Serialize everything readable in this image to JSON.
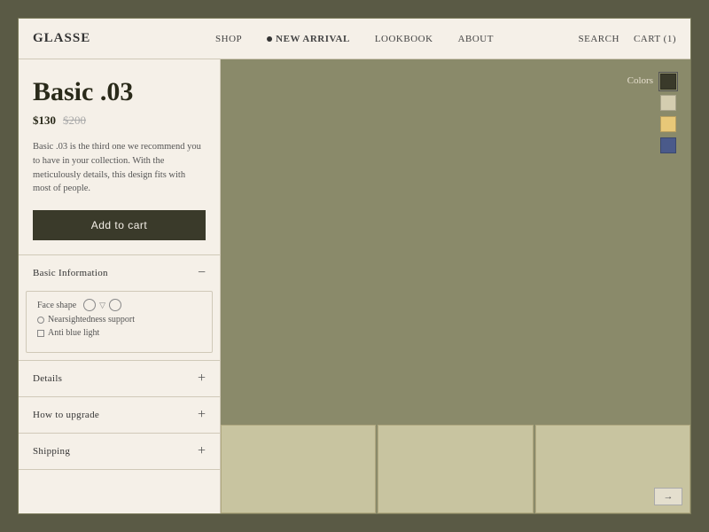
{
  "navbar": {
    "logo": "GLASSE",
    "nav_items": [
      {
        "label": "SHOP",
        "active": false,
        "dot": false
      },
      {
        "label": "NEW ARRIVAL",
        "active": true,
        "dot": true
      },
      {
        "label": "LOOKBOOK",
        "active": false,
        "dot": false
      },
      {
        "label": "ABOUT",
        "active": false,
        "dot": false
      }
    ],
    "search_label": "Search",
    "cart_label": "Cart (1)"
  },
  "product": {
    "title": "Basic .03",
    "price_current": "$130",
    "price_original": "$200",
    "description": "Basic .03 is the third one we recommend you to have in your collection. With the meticulously details, this design fits with most of people.",
    "add_to_cart_label": "Add to cart"
  },
  "accordion": {
    "basic_info": {
      "label": "Basic Information",
      "icon_open": "−",
      "face_shape_label": "Face shape",
      "features": [
        {
          "icon": "circle",
          "label": "Nearsightedness support"
        },
        {
          "icon": "square",
          "label": "Anti blue light"
        }
      ]
    },
    "details": {
      "label": "Details",
      "icon": "+"
    },
    "upgrade": {
      "label": "How to upgrade",
      "icon": "+"
    },
    "shipping": {
      "label": "Shipping",
      "icon": "+"
    }
  },
  "colors": {
    "label": "Colors",
    "swatches": [
      {
        "color": "#3a3a2a",
        "active": true
      },
      {
        "color": "#d4cdb0",
        "active": false
      },
      {
        "color": "#e8c878",
        "active": false
      },
      {
        "color": "#4a5a8a",
        "active": false
      }
    ]
  },
  "thumbnails": {
    "count": 3,
    "arrow_label": "→"
  }
}
